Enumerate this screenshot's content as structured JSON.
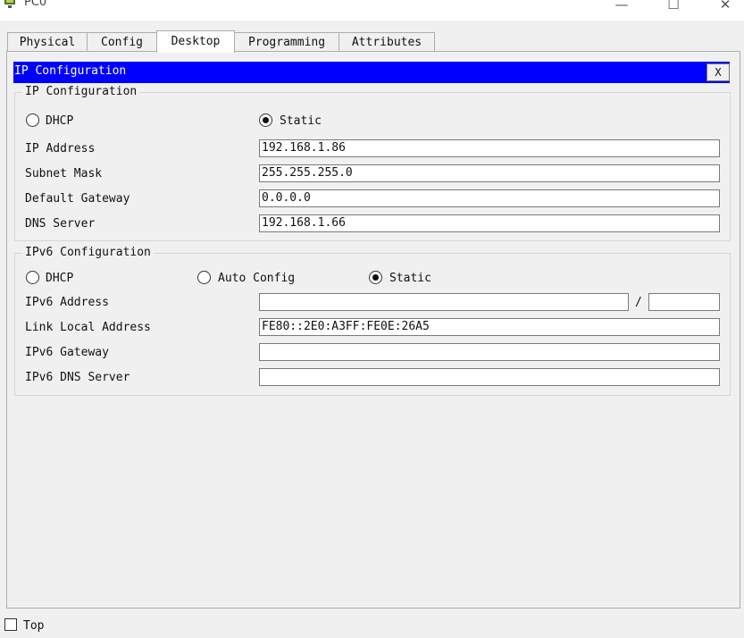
{
  "window": {
    "title": "PC0",
    "minimize": "—",
    "maximize": "☐",
    "close": "✕"
  },
  "tabs": [
    {
      "label": "Physical"
    },
    {
      "label": "Config"
    },
    {
      "label": "Desktop"
    },
    {
      "label": "Programming"
    },
    {
      "label": "Attributes"
    }
  ],
  "header": {
    "title": "IP Configuration",
    "close_label": "X"
  },
  "ipv4": {
    "group_title": "IP Configuration",
    "dhcp_label": "DHCP",
    "static_label": "Static",
    "mode": "static",
    "ip_label": "IP Address",
    "ip_value": "192.168.1.86",
    "mask_label": "Subnet Mask",
    "mask_value": "255.255.255.0",
    "gateway_label": "Default Gateway",
    "gateway_value": "0.0.0.0",
    "dns_label": "DNS Server",
    "dns_value": "192.168.1.66"
  },
  "ipv6": {
    "group_title": "IPv6 Configuration",
    "dhcp_label": "DHCP",
    "auto_label": "Auto Config",
    "static_label": "Static",
    "mode": "static",
    "address_label": "IPv6 Address",
    "address_value": "",
    "slash": "/",
    "prefix_value": "",
    "link_local_label": "Link Local Address",
    "link_local_value": "FE80::2E0:A3FF:FE0E:26A5",
    "gateway_label": "IPv6 Gateway",
    "gateway_value": "",
    "dns_label": "IPv6 DNS Server",
    "dns_value": ""
  },
  "footer": {
    "top_label": "Top",
    "top_checked": false
  }
}
